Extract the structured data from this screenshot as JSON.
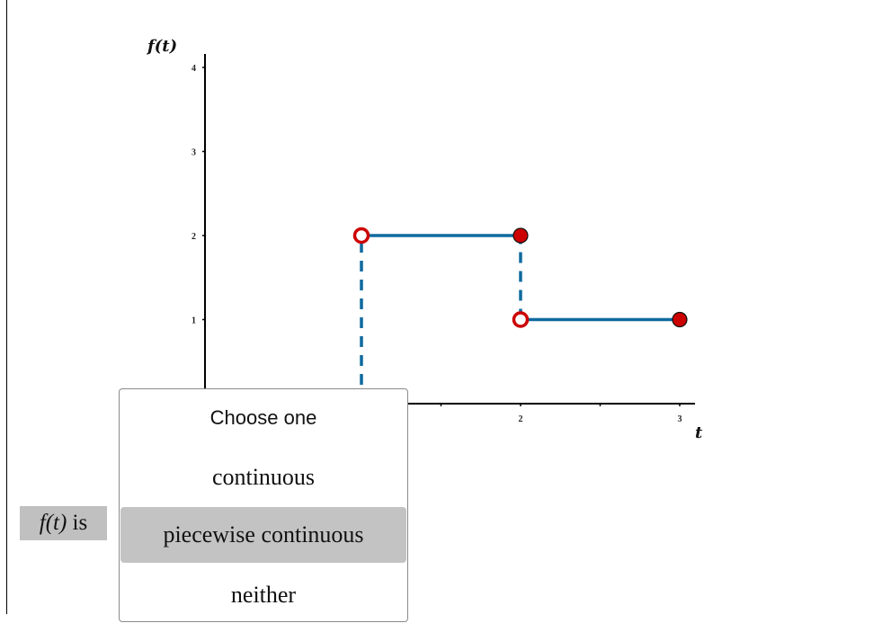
{
  "chart_data": {
    "type": "line",
    "title": "",
    "xlabel": "t",
    "ylabel": "f(t)",
    "xlim": [
      0,
      3
    ],
    "ylim": [
      0,
      4
    ],
    "x_ticks": [
      0.5,
      1,
      1.5,
      2,
      2.5,
      3
    ],
    "x_tick_labels": [
      "",
      "",
      "",
      "2",
      "",
      "3"
    ],
    "y_ticks": [
      1,
      2,
      3,
      4
    ],
    "y_tick_labels": [
      "1",
      "2",
      "3",
      "4"
    ],
    "grid": false,
    "series": [
      {
        "name": "segment-1",
        "style": "solid",
        "points": [
          [
            1,
            2
          ],
          [
            2,
            2
          ]
        ]
      },
      {
        "name": "segment-2",
        "style": "solid",
        "points": [
          [
            2,
            1
          ],
          [
            3,
            1
          ]
        ]
      },
      {
        "name": "jump-at-1",
        "style": "dashed",
        "points": [
          [
            1,
            0
          ],
          [
            1,
            2
          ]
        ]
      },
      {
        "name": "jump-at-2",
        "style": "dashed",
        "points": [
          [
            2,
            1
          ],
          [
            2,
            2
          ]
        ]
      }
    ],
    "markers": [
      {
        "x": 1,
        "y": 2,
        "type": "open"
      },
      {
        "x": 2,
        "y": 2,
        "type": "closed"
      },
      {
        "x": 2,
        "y": 1,
        "type": "open"
      },
      {
        "x": 3,
        "y": 1,
        "type": "closed"
      }
    ],
    "colors": {
      "line": "#0f6a9e",
      "marker": "#cc0000",
      "marker_edge": "#111111",
      "axis": "#000000"
    }
  },
  "question": {
    "prompt_fn": "f(t)",
    "prompt_suffix": " is"
  },
  "dropdown": {
    "placeholder": "Choose one",
    "options": [
      "continuous",
      "piecewise continuous",
      "neither"
    ],
    "highlighted": "piecewise continuous"
  }
}
